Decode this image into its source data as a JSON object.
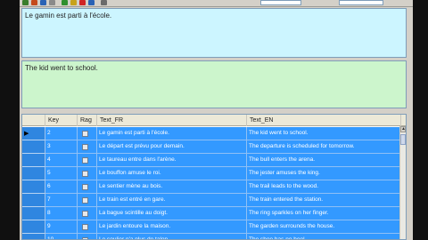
{
  "toolbar": {
    "icon_colors": [
      "#3a7d2c",
      "#c44a1b",
      "#2a63b5",
      "#8a8a8a",
      "#2f8f2f",
      "#c7a21a",
      "#d02525",
      "#2a63b5",
      "#6b6b6b"
    ],
    "label_left": "",
    "label_right": ""
  },
  "editors": {
    "french_text": "Le gamin est parti à l'école.",
    "english_text": "The kid went to school."
  },
  "grid": {
    "columns": {
      "key": "Key",
      "rag": "Rag",
      "text_fr": "Text_FR",
      "text_en": "Text_EN"
    },
    "selection_color": "#3399ff",
    "rows": [
      {
        "key": "2",
        "text_fr": "Le gamin est parti à l'école.",
        "text_en": "The kid went to school.",
        "current": true
      },
      {
        "key": "3",
        "text_fr": "Le départ est prévu pour demain.",
        "text_en": "The departure is scheduled for tomorrow.",
        "current": false
      },
      {
        "key": "4",
        "text_fr": "Le taureau entre dans l'arène.",
        "text_en": "The bull enters the arena.",
        "current": false
      },
      {
        "key": "5",
        "text_fr": "Le bouffon amuse le roi.",
        "text_en": "The jester amuses the king.",
        "current": false
      },
      {
        "key": "6",
        "text_fr": "Le sentier mène au bois.",
        "text_en": "The trail leads to the wood.",
        "current": false
      },
      {
        "key": "7",
        "text_fr": "Le train est entré en gare.",
        "text_en": "The train entered the station.",
        "current": false
      },
      {
        "key": "8",
        "text_fr": "La bague scintille au doigt.",
        "text_en": "The ring sparkles on her finger.",
        "current": false
      },
      {
        "key": "9",
        "text_fr": "Le jardin entoure la maison.",
        "text_en": "The garden surrounds the house.",
        "current": false
      },
      {
        "key": "10",
        "text_fr": "Le soulier n'a plus de talon.",
        "text_en": "The shoe has no heel.",
        "current": false
      }
    ]
  }
}
